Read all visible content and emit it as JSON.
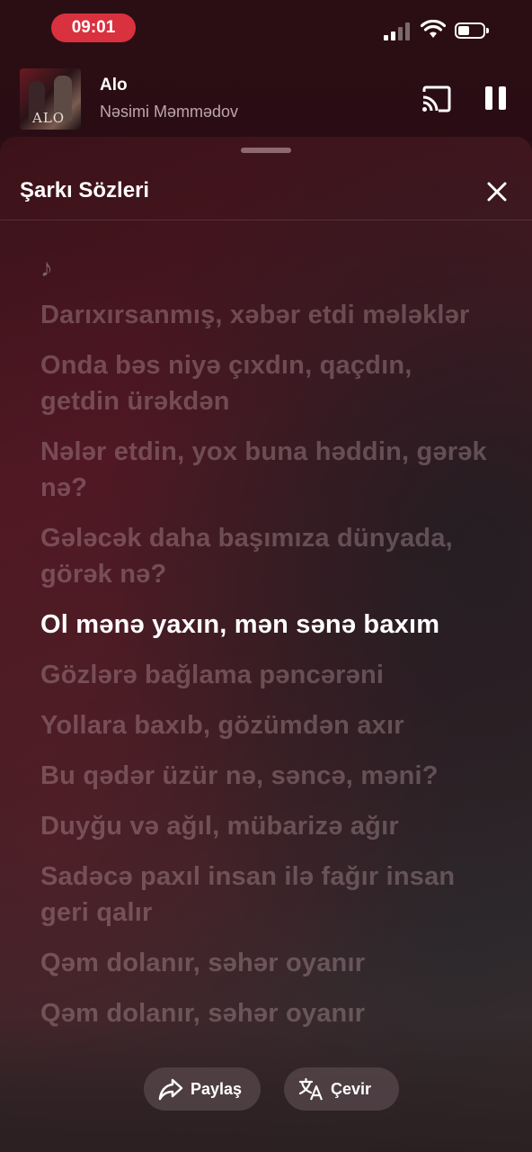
{
  "status_bar": {
    "time": "09:01"
  },
  "mini_player": {
    "title": "Alo",
    "artist": "Nəsimi Məmmədov",
    "album_art_text": "ALO"
  },
  "sheet": {
    "title": "Şarkı Sözleri",
    "note_symbol": "♪",
    "lyrics": [
      "Darıxırsanmış, xəbər etdi mələklər",
      "Onda bəs niyə çıxdın, qaçdın, getdin ürəkdən",
      "Nələr etdin, yox buna həddin, gərək nə?",
      "Gələcək daha başımıza dünyada, görək nə?",
      "Ol mənə yaxın, mən sənə baxım",
      "Gözlərə bağlama pəncərəni",
      "Yollara baxıb, gözümdən axır",
      "Bu qədər üzür nə, səncə, məni?",
      "Duyğu və ağıl, mübarizə ağır",
      "Sadəcə paxıl insan ilə fağır insan geri qalır",
      "Qəm dolanır, səhər oyanır",
      "Qəm dolanır, səhər oyanır"
    ],
    "active_index": 4
  },
  "actions": {
    "share_label": "Paylaş",
    "translate_label": "Çevir"
  },
  "colors": {
    "time_pill": "#d9313e",
    "active_lyric": "#ffffff"
  }
}
